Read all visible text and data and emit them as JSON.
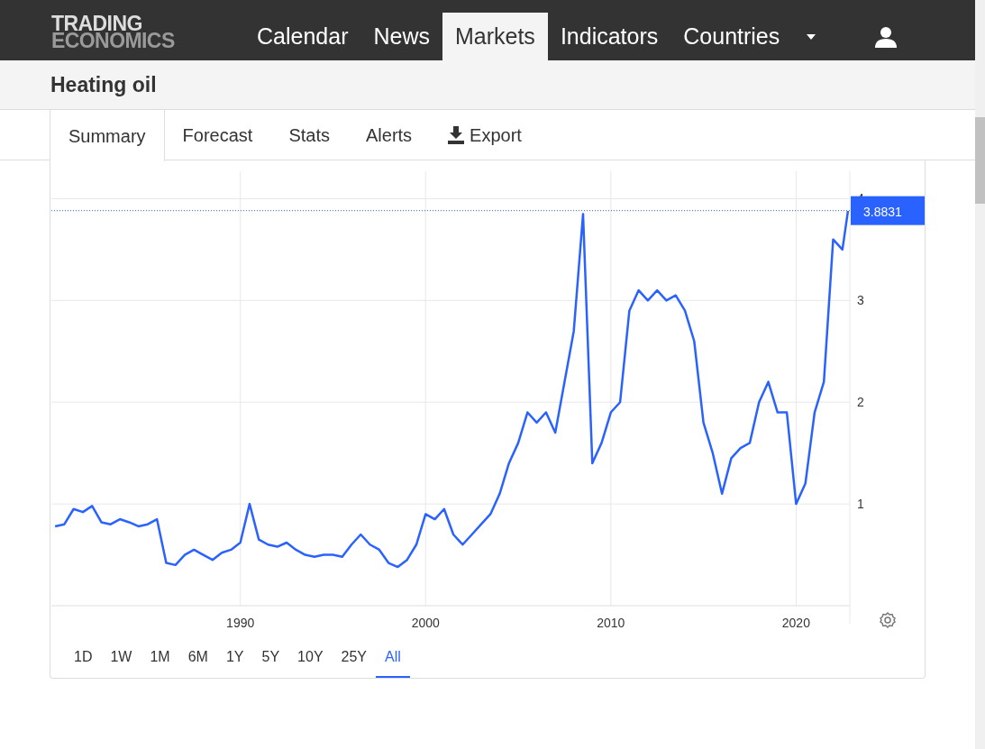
{
  "nav": {
    "logo": [
      "TRADING",
      "ECONOMICS"
    ],
    "items": [
      {
        "label": "Calendar",
        "selected": false
      },
      {
        "label": "News",
        "selected": false
      },
      {
        "label": "Markets",
        "selected": true
      },
      {
        "label": "Indicators",
        "selected": false
      },
      {
        "label": "Countries",
        "selected": false
      }
    ]
  },
  "page_title": "Heating oil",
  "tabs": [
    {
      "label": "Summary",
      "kind": "tab",
      "selected": true
    },
    {
      "label": "Forecast",
      "kind": "tab",
      "selected": false
    },
    {
      "label": "Stats",
      "kind": "tab",
      "selected": false
    },
    {
      "label": "Alerts",
      "kind": "tab",
      "selected": false
    },
    {
      "label": "Export",
      "kind": "download",
      "selected": false
    }
  ],
  "chart": {
    "chart_data": {
      "type": "line",
      "x": [
        1980,
        1980.5,
        1981,
        1981.5,
        1982,
        1982.5,
        1983,
        1983.5,
        1984,
        1984.5,
        1985,
        1985.5,
        1986,
        1986.5,
        1987,
        1987.5,
        1988,
        1988.5,
        1989,
        1989.5,
        1990,
        1990.5,
        1991,
        1991.5,
        1992,
        1992.5,
        1993,
        1993.5,
        1994,
        1994.5,
        1995,
        1995.5,
        1996,
        1996.5,
        1997,
        1997.5,
        1998,
        1998.5,
        1999,
        1999.5,
        2000,
        2000.5,
        2001,
        2001.5,
        2002,
        2002.5,
        2003,
        2003.5,
        2004,
        2004.5,
        2005,
        2005.5,
        2006,
        2006.5,
        2007,
        2007.5,
        2008,
        2008.5,
        2009,
        2009.5,
        2010,
        2010.5,
        2011,
        2011.5,
        2012,
        2012.5,
        2013,
        2013.5,
        2014,
        2014.5,
        2015,
        2015.5,
        2016,
        2016.5,
        2017,
        2017.5,
        2018,
        2018.5,
        2019,
        2019.5,
        2020,
        2020.5,
        2021,
        2021.5,
        2022,
        2022.5,
        2022.8
      ],
      "series": [
        {
          "color": "#2962ff",
          "values": [
            0.78,
            0.8,
            0.95,
            0.92,
            0.98,
            0.82,
            0.8,
            0.85,
            0.82,
            0.78,
            0.8,
            0.85,
            0.42,
            0.4,
            0.5,
            0.55,
            0.5,
            0.45,
            0.52,
            0.55,
            0.62,
            1.0,
            0.65,
            0.6,
            0.58,
            0.62,
            0.55,
            0.5,
            0.48,
            0.5,
            0.5,
            0.48,
            0.6,
            0.7,
            0.6,
            0.55,
            0.42,
            0.38,
            0.45,
            0.6,
            0.9,
            0.85,
            0.95,
            0.7,
            0.6,
            0.7,
            0.8,
            0.9,
            1.1,
            1.4,
            1.6,
            1.9,
            1.8,
            1.9,
            1.7,
            2.2,
            2.7,
            3.85,
            1.4,
            1.6,
            1.9,
            2.0,
            2.9,
            3.1,
            3.0,
            3.1,
            3.0,
            3.05,
            2.9,
            2.6,
            1.8,
            1.5,
            1.1,
            1.45,
            1.55,
            1.6,
            2.0,
            2.2,
            1.9,
            1.9,
            1.0,
            1.2,
            1.9,
            2.2,
            3.6,
            3.5,
            3.88
          ]
        }
      ],
      "xlim": [
        1979.8,
        2022.9
      ],
      "ylim": [
        0,
        4.27
      ],
      "xticks": [
        1990,
        2000,
        2010,
        2020
      ],
      "yticks": [
        1,
        2,
        3,
        4
      ],
      "grid": true,
      "ref_lines": [
        {
          "axis": "y",
          "value": 3.8831,
          "label": "3.8831"
        }
      ]
    }
  },
  "ranges": [
    {
      "label": "1D",
      "selected": false
    },
    {
      "label": "1W",
      "selected": false
    },
    {
      "label": "1M",
      "selected": false
    },
    {
      "label": "6M",
      "selected": false
    },
    {
      "label": "1Y",
      "selected": false
    },
    {
      "label": "5Y",
      "selected": false
    },
    {
      "label": "10Y",
      "selected": false
    },
    {
      "label": "25Y",
      "selected": false
    },
    {
      "label": "All",
      "selected": true
    }
  ]
}
